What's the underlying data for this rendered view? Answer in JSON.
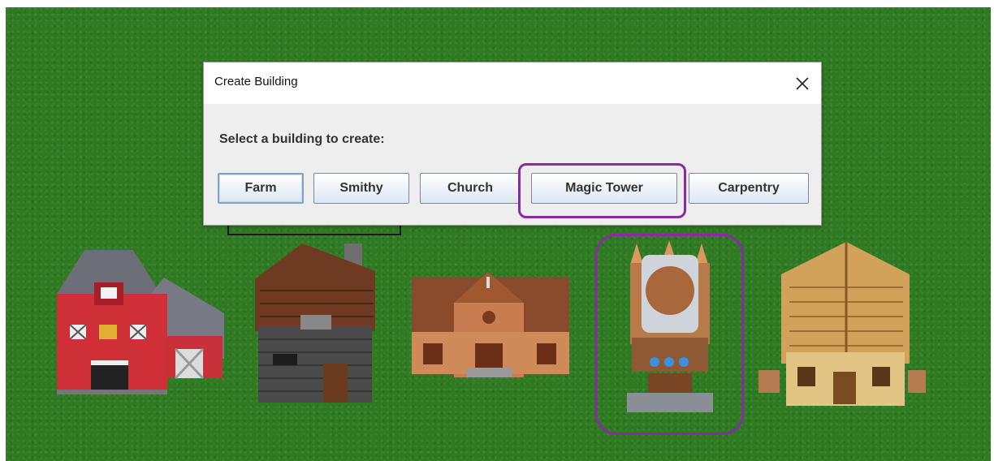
{
  "dialog": {
    "title": "Create Building",
    "close_glyph": "✕",
    "prompt": "Select a building to create:",
    "buttons": [
      {
        "label": "Farm",
        "focused": true
      },
      {
        "label": "Smithy"
      },
      {
        "label": "Church"
      },
      {
        "label": "Magic Tower",
        "highlighted": true
      },
      {
        "label": "Carpentry"
      }
    ]
  },
  "highlight_color": "#8a2aa6",
  "background_color": "#2f7a22",
  "buildings": [
    {
      "name": "farm",
      "icon": "barn-icon"
    },
    {
      "name": "smithy",
      "icon": "smithy-icon"
    },
    {
      "name": "church",
      "icon": "church-icon"
    },
    {
      "name": "magic-tower",
      "icon": "magic-tower-icon",
      "highlighted": true
    },
    {
      "name": "carpentry",
      "icon": "carpentry-icon"
    }
  ]
}
